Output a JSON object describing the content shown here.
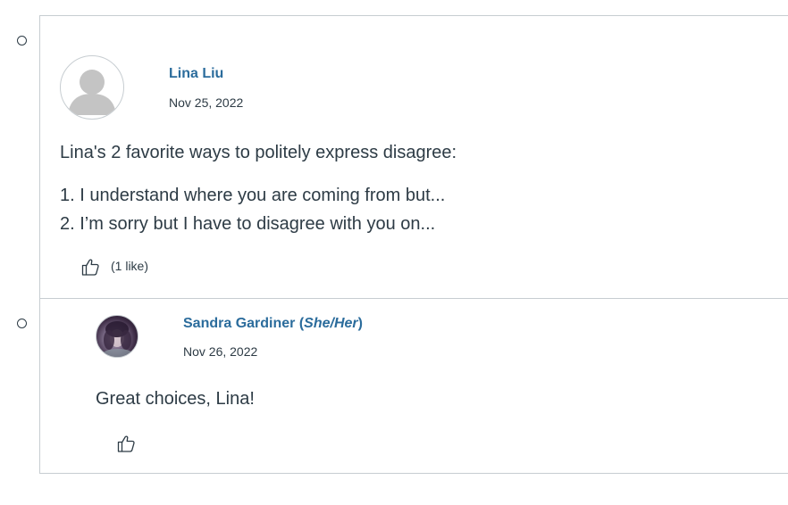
{
  "entries": [
    {
      "author": "Lina Liu",
      "date": "Nov 25, 2022",
      "intro": "Lina's 2 favorite ways to politely express disagree:",
      "list": [
        "1. I understand where you are coming from but...",
        "2. I’m sorry but I have to disagree with you on..."
      ],
      "likes": "(1 like)",
      "avatar": "default-user-icon"
    },
    {
      "author_name": "Sandra Gardiner (",
      "author_pronouns": "She/Her",
      "author_close": ")",
      "date": "Nov 26, 2022",
      "text": "Great choices, Lina!",
      "avatar": "user-photo"
    }
  ],
  "colors": {
    "link": "#2b6c9c",
    "text": "#2d3b45",
    "border": "#c7cdd1"
  },
  "icons": [
    "radio-icon",
    "thumbs-up-icon",
    "default-user-icon"
  ]
}
